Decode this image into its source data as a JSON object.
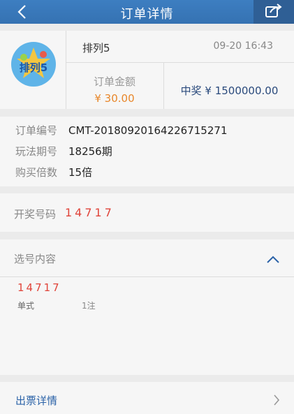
{
  "nav": {
    "title": "订单详情",
    "back_icon": "back-chevron-icon",
    "share_icon": "share-icon"
  },
  "summary": {
    "lottery_name": "排列5",
    "logo_text": "排列5",
    "time": "09-20 16:43",
    "amount_label": "订单金额",
    "amount": "¥ 30.00",
    "prize": "中奖 ¥ 1500000.00"
  },
  "info": {
    "order_no_label": "订单编号",
    "order_no": "CMT-20180920164226715271",
    "issue_label": "玩法期号",
    "issue": "18256期",
    "multiple_label": "购买倍数",
    "multiple": "15倍"
  },
  "draw": {
    "label": "开奖号码",
    "numbers": "14717"
  },
  "picks": {
    "label": "选号内容",
    "numbers": "14717",
    "type": "单式",
    "count": "1注"
  },
  "ticket": {
    "label": "出票详情"
  },
  "colors": {
    "nav": "#3572b2",
    "red": "#e0443a",
    "orange": "#e8872b",
    "blue": "#2c63a8"
  }
}
